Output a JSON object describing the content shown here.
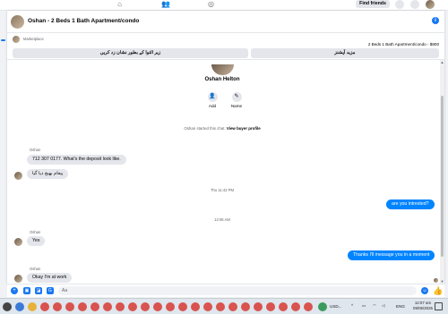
{
  "topnav": {
    "find_friends_label": "Find friends"
  },
  "chat": {
    "title": "Oshan - 2 Beds 1 Bath Apartment/condo",
    "info_icon": "info-icon"
  },
  "listing": {
    "marketplace_label": "Marketplace",
    "listing_title": "2 Beds 1 Bath Apartment/condo - $800",
    "mark_pending_label": "زیر التوا کے بطور نشان زد کریں",
    "more_options_label": "مزید آپشنز"
  },
  "profile": {
    "name": "Oshan Helton",
    "add_label": "Add",
    "name_label": "Name",
    "started_text": "Oshan started this chat.",
    "view_buyer_profile": "View buyer profile"
  },
  "messages": {
    "sender_1": "Oshan",
    "msg_1": "712 307 0177. What's the deposit look like.",
    "msg_2": "پیغام بھیج دیا گیا",
    "time_1": "Thu 11:42 PM",
    "msg_3": "are you intrested?",
    "time_2": "12:06 AM",
    "sender_2": "Oshan",
    "msg_4": "Yes",
    "msg_5": "Thanks I'll message you in a moment",
    "sender_3": "Oshan",
    "msg_6": "Okay I'm at work"
  },
  "composer": {
    "placeholder": "Aa"
  },
  "taskbar": {
    "ticker": "USD...",
    "language": "ENG",
    "time": "12:07 am",
    "date": "09/05/2025"
  },
  "colors": {
    "accent": "#1877f2",
    "outgoing_bubble": "#0084ff",
    "incoming_bubble": "#e4e6eb"
  }
}
